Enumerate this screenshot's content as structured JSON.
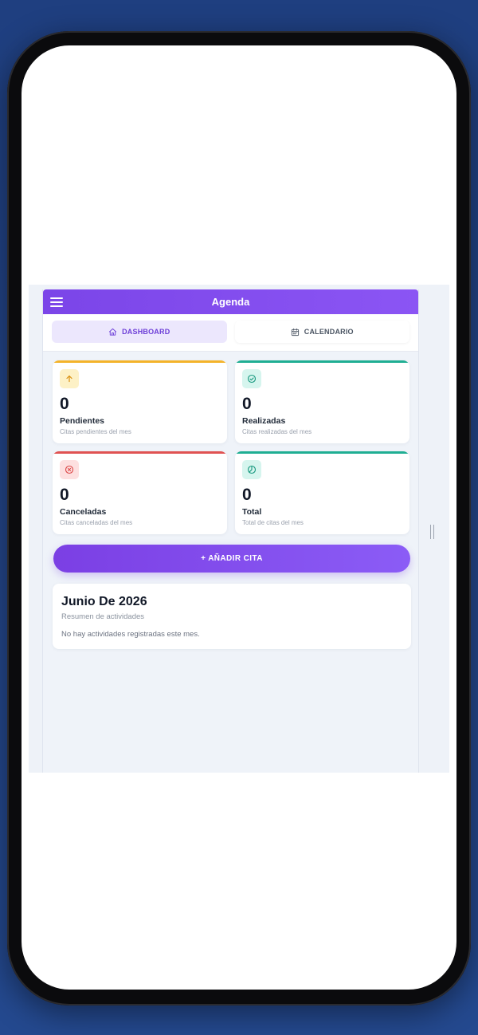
{
  "app": {
    "title": "Agenda"
  },
  "tabs": [
    {
      "label": "DASHBOARD",
      "icon": "home-icon",
      "active": true
    },
    {
      "label": "CALENDARIO",
      "icon": "calendar-icon",
      "active": false
    }
  ],
  "stats": [
    {
      "value": "0",
      "label": "Pendientes",
      "sub": "Citas pendientes del mes",
      "icon": "arrow-up-icon",
      "accent": "#f4b32a",
      "icon_bg": "#fdf1c6",
      "icon_color": "#d9900f"
    },
    {
      "value": "0",
      "label": "Realizadas",
      "sub": "Citas realizadas del mes",
      "icon": "check-circle-icon",
      "accent": "#1fae93",
      "icon_bg": "#d6f5ee",
      "icon_color": "#18997f"
    },
    {
      "value": "0",
      "label": "Canceladas",
      "sub": "Citas canceladas del mes",
      "icon": "x-circle-icon",
      "accent": "#e05252",
      "icon_bg": "#fde0e0",
      "icon_color": "#dc4747"
    },
    {
      "value": "0",
      "label": "Total",
      "sub": "Total de citas del mes",
      "icon": "pie-chart-icon",
      "accent": "#1fae93",
      "icon_bg": "#d6f5ee",
      "icon_color": "#18997f"
    }
  ],
  "actions": {
    "add_label": "+ AÑADIR CITA"
  },
  "summary": {
    "title": "Junio De 2026",
    "subtitle": "Resumen de actividades",
    "empty": "No hay actividades registradas este mes."
  },
  "colors": {
    "primary": "#7b45e8",
    "background": "#eff3f9"
  }
}
